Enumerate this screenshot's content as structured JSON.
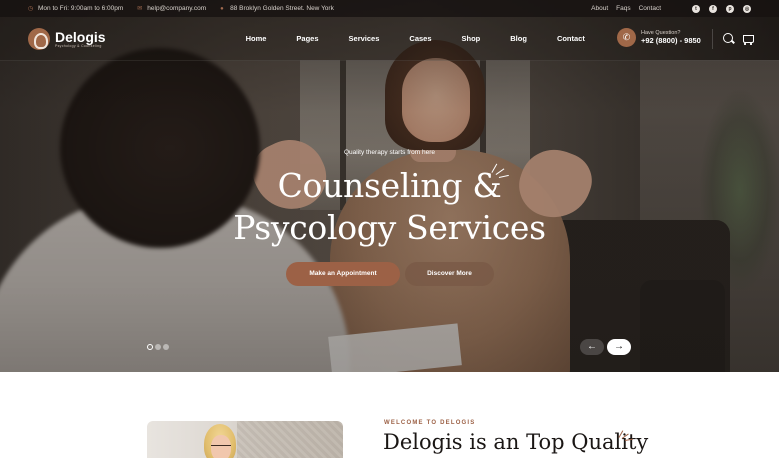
{
  "topbar": {
    "hours": "Mon to Fri: 9:00am to 6:00pm",
    "email": "help@company.com",
    "address": "88 Broklyn Golden Street. New York",
    "links": [
      "About",
      "Faqs",
      "Contact"
    ],
    "social": [
      "twitter-icon",
      "facebook-icon",
      "pinterest-icon",
      "instagram-icon"
    ]
  },
  "nav": {
    "brand": "Delogis",
    "brand_sub": "Psychology & Counseling",
    "menu": [
      "Home",
      "Pages",
      "Services",
      "Cases",
      "Shop",
      "Blog",
      "Contact"
    ],
    "phone_label": "Have Question?",
    "phone_number": "+92 (8800) - 9850"
  },
  "hero": {
    "tagline": "Quality therapy starts from here",
    "title_line1": "Counseling &",
    "title_line2": "Psycology Services",
    "primary_button": "Make an Appointment",
    "secondary_button": "Discover More",
    "slide_count": 3,
    "active_slide": 1
  },
  "welcome": {
    "kicker": "WELCOME TO DELOGIS",
    "title": "Delogis is an Top Quality"
  },
  "colors": {
    "accent": "#9c6146",
    "dark": "#1a1614"
  }
}
